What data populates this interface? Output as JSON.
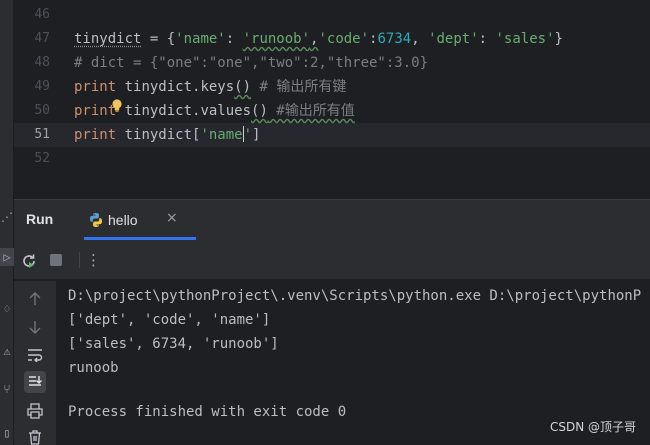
{
  "editor": {
    "line_numbers": [
      "46",
      "47",
      "48",
      "49",
      "50",
      "51",
      "52"
    ],
    "current_line": "51",
    "lines": {
      "l47": {
        "var": "tinydict",
        "op": " = {",
        "k1": "'name'",
        "c1": ": ",
        "v1": "'runoob'",
        "c2": ",",
        "k2": "'code'",
        "c3": ":",
        "v2": "6734",
        "c4": ", ",
        "k3": "'dept'",
        "c5": ": ",
        "v3": "'sales'",
        "end": "}"
      },
      "l48": "# dict = {\"one\":\"one\",\"two\":2,\"three\":3.0}",
      "l49": {
        "kw": "print",
        "code": " tinydict.keys",
        "call": "()",
        "cmt": " # 输出所有键"
      },
      "l50": {
        "kw": "print",
        "code": " tinydict.values",
        "call": "()",
        "cmt": " #输出所有值"
      },
      "l51": {
        "kw": "print",
        "code": " tinydict[",
        "str1": "'name",
        "str2": "'",
        "end": "]"
      }
    },
    "intention_icon": "lightbulb-icon"
  },
  "run_panel": {
    "title": "Run",
    "tab": {
      "label": "hello",
      "icon": "python-icon",
      "close": "×"
    },
    "toolbar": {
      "rerun_icon": "rerun-icon",
      "stop_icon": "stop-icon",
      "more": "⋮"
    },
    "side_tools": [
      "up-arrow-icon",
      "down-arrow-icon",
      "soft-wrap-icon",
      "scroll-to-end-icon",
      "print-icon",
      "trash-icon"
    ],
    "output": [
      "D:\\project\\pythonProject\\.venv\\Scripts\\python.exe D:\\project\\pythonP",
      "['dept', 'code', 'name']",
      "['sales', 6734, 'runoob']",
      "runoob",
      "",
      "Process finished with exit code 0"
    ]
  },
  "watermark": "CSDN @顶子哥",
  "colors": {
    "accent": "#3574f0",
    "keyword": "#cf8e6d",
    "string": "#6aab73",
    "number": "#2aacb8",
    "comment": "#7a7e85"
  }
}
